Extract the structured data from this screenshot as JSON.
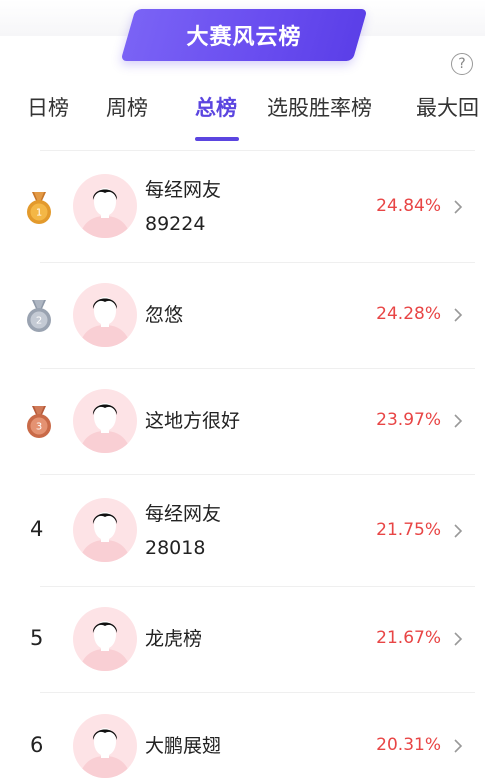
{
  "header": {
    "title": "大赛风云榜"
  },
  "help": {
    "glyph": "?"
  },
  "tabs": [
    {
      "label": "日榜"
    },
    {
      "label": "周榜"
    },
    {
      "label": "总榜"
    },
    {
      "label": "选股胜率榜"
    },
    {
      "label": "最大回"
    }
  ],
  "active_tab": "总榜",
  "rows": [
    {
      "rank": "1",
      "medal": "gold-medal",
      "name_lines": [
        "每经网友",
        "89224"
      ],
      "rate": "24.84%"
    },
    {
      "rank": "2",
      "medal": "silver-medal",
      "name_lines": [
        "忽悠"
      ],
      "rate": "24.28%"
    },
    {
      "rank": "3",
      "medal": "bronze-medal",
      "name_lines": [
        "这地方很好"
      ],
      "rate": "23.97%"
    },
    {
      "rank": "4",
      "name_lines": [
        "每经网友",
        "28018"
      ],
      "rate": "21.75%"
    },
    {
      "rank": "5",
      "name_lines": [
        "龙虎榜"
      ],
      "rate": "21.67%"
    },
    {
      "rank": "6",
      "name_lines": [
        "大鹏展翅"
      ],
      "rate": "20.31%"
    }
  ],
  "colors": {
    "accent": "#5b45e0",
    "rate": "#e84545",
    "avatar_bg": "#fde3e6"
  }
}
